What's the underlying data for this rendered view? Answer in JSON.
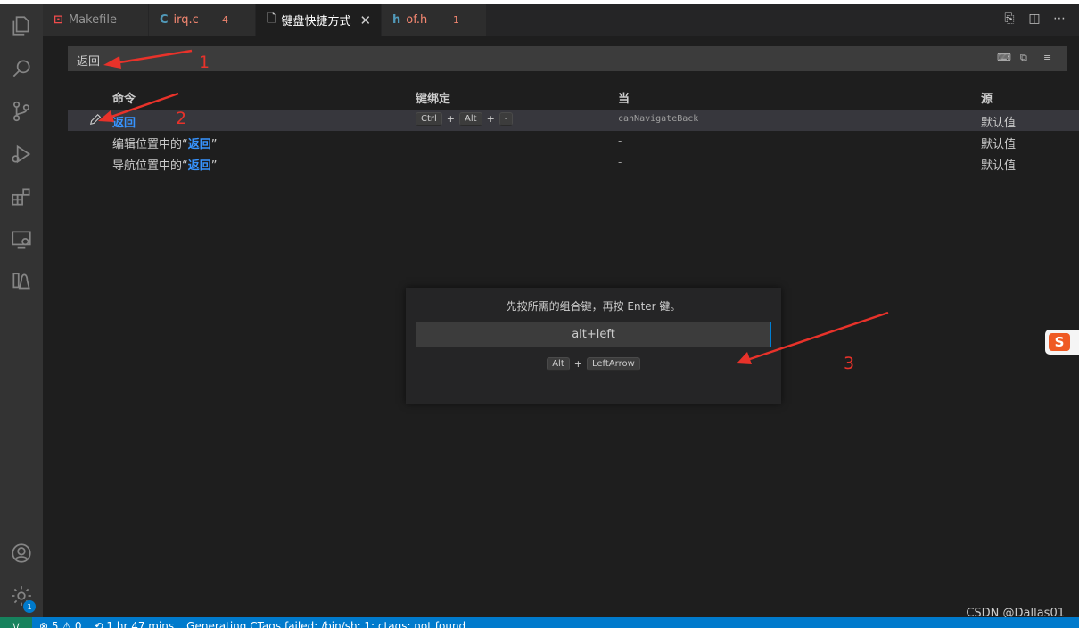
{
  "tabs": [
    {
      "icon": "makefile-icon",
      "label": "Makefile",
      "count": "",
      "color": "#f14c4c"
    },
    {
      "icon": "c-file-icon",
      "label": "irq.c",
      "count": "4",
      "color": "#f48771"
    },
    {
      "icon": "document-icon",
      "label": "键盘快捷方式",
      "count": "",
      "close": "✕",
      "color": "#ffffff"
    },
    {
      "icon": "h-file-icon",
      "label": "of.h",
      "count": "1",
      "color": "#f48771"
    }
  ],
  "search": {
    "value": "返回"
  },
  "table": {
    "headers": {
      "command": "命令",
      "keybinding": "键绑定",
      "when": "当",
      "source": "源"
    },
    "rows": [
      {
        "command_pre": "",
        "command_hl": "返回",
        "command_post": "",
        "keys": [
          "Ctrl",
          "Alt",
          "-"
        ],
        "when": "canNavigateBack",
        "source": "默认值"
      },
      {
        "command_pre": "编辑位置中的“",
        "command_hl": "返回",
        "command_post": "”",
        "keys": [],
        "when": "-",
        "source": "默认值"
      },
      {
        "command_pre": "导航位置中的“",
        "command_hl": "返回",
        "command_post": "”",
        "keys": [],
        "when": "-",
        "source": "默认值"
      }
    ]
  },
  "dialog": {
    "message": "先按所需的组合键，再按 Enter 键。",
    "input_value": "alt+left",
    "keys": [
      "Alt",
      "LeftArrow"
    ]
  },
  "annotations": [
    "1",
    "2",
    "3"
  ],
  "statusbar": {
    "remote_icon": "remote-icon",
    "problems": "⊗ 5 ⚠ 0",
    "time": "⟲ 1 hr 47 mins",
    "message": "Generating CTags failed: /bin/sh: 1: ctags: not found"
  },
  "activity_badge": "1",
  "watermark": "CSDN @Dallas01",
  "colors": {
    "accent": "#007acc",
    "highlight": "#3794ff",
    "annotation": "#e8322a"
  }
}
